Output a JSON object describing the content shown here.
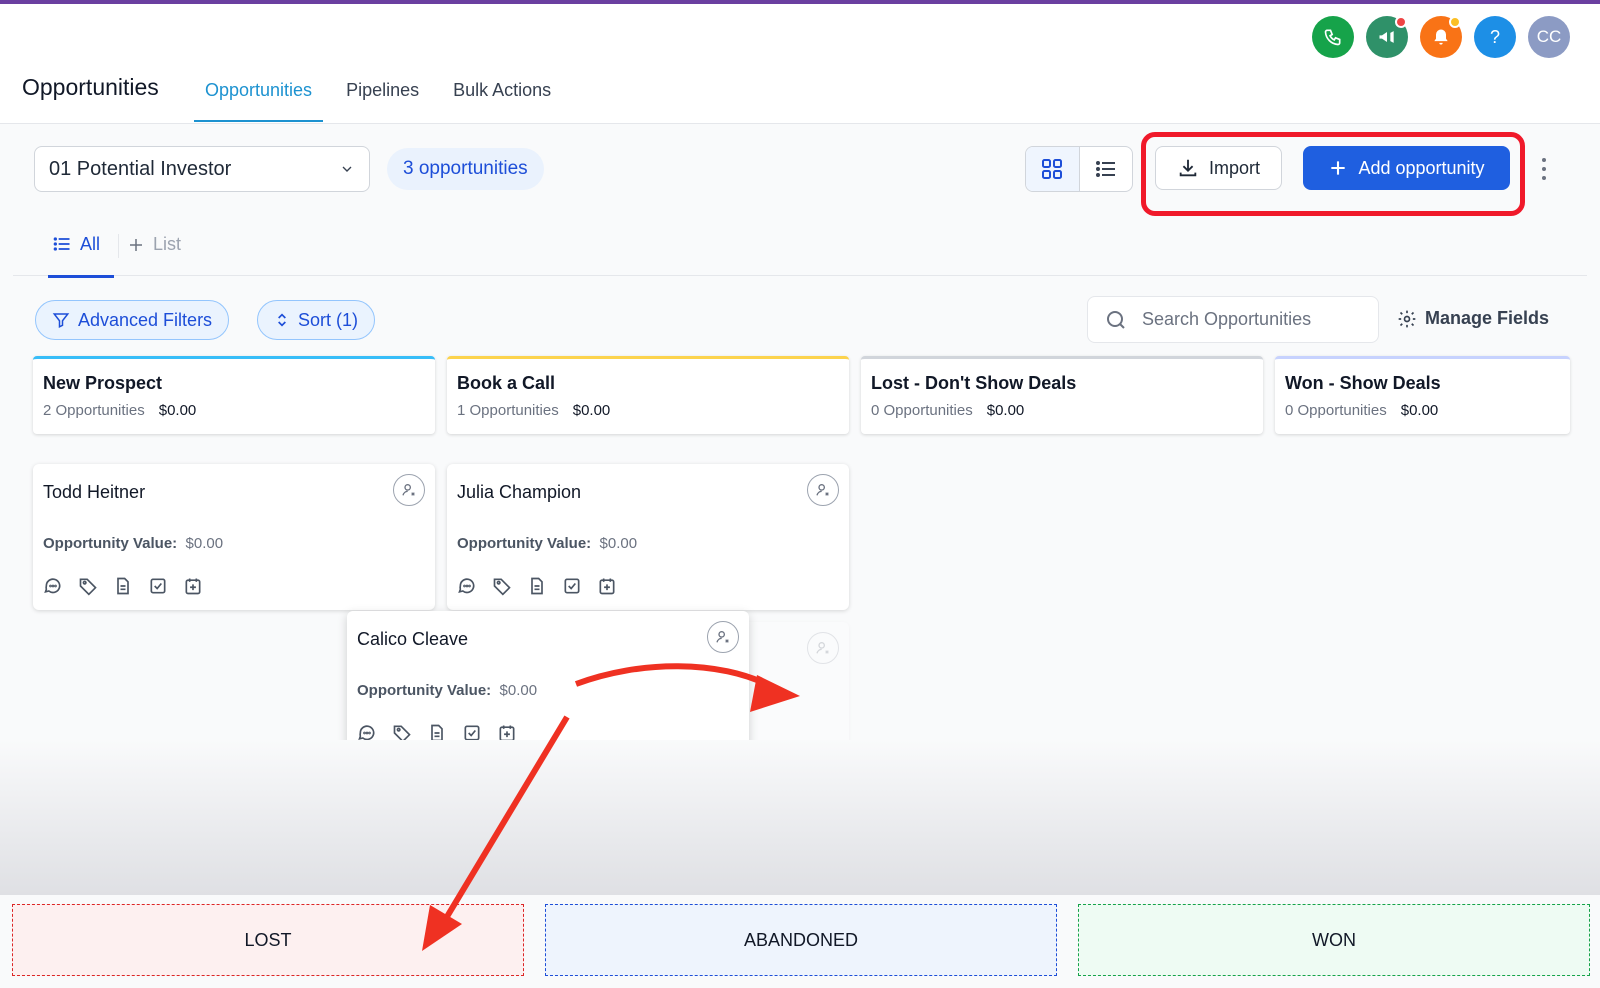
{
  "header": {
    "page_title": "Opportunities",
    "tabs": [
      {
        "label": "Opportunities",
        "active": true
      },
      {
        "label": "Pipelines"
      },
      {
        "label": "Bulk Actions"
      }
    ],
    "icons": [
      {
        "name": "phone-icon",
        "color": "#16a34a"
      },
      {
        "name": "megaphone-icon",
        "color": "#2f9169"
      },
      {
        "name": "bell-icon",
        "color": "#f97316"
      },
      {
        "name": "help-icon",
        "color": "#1d8fe6"
      }
    ],
    "avatar_initials": "CC"
  },
  "toolbar": {
    "pipeline": "01 Potential Investor",
    "count": "3 opportunities",
    "import_label": "Import",
    "add_label": "Add opportunity"
  },
  "list_tabs": {
    "all_label": "All",
    "list_label": "List"
  },
  "filters": {
    "advanced_label": "Advanced Filters",
    "sort_label": "Sort (1)",
    "search_placeholder": "Search Opportunities",
    "manage_fields_label": "Manage Fields"
  },
  "columns": [
    {
      "title": "New Prospect",
      "count": "2 Opportunities",
      "value": "$0.00",
      "accent": "#38bdf8"
    },
    {
      "title": "Book a Call",
      "count": "1 Opportunities",
      "value": "$0.00",
      "accent": "#fcd34d"
    },
    {
      "title": "Lost - Don't Show Deals",
      "count": "0 Opportunities",
      "value": "$0.00",
      "accent": "#d1d5db"
    },
    {
      "title": "Won - Show Deals",
      "count": "0 Opportunities",
      "value": "$0.00",
      "accent": "#c7d2fe"
    }
  ],
  "cards": [
    {
      "name": "Todd Heitner",
      "value_label": "Opportunity Value:",
      "value": "$0.00"
    },
    {
      "name": "Julia Champion",
      "value_label": "Opportunity Value:",
      "value": "$0.00"
    },
    {
      "name": "Calico Cleave",
      "value_label": "Opportunity Value:",
      "value": "$0.00"
    }
  ],
  "drop_zones": [
    {
      "label": "LOST",
      "bg": "#fdf0f0",
      "border": "#dc2626"
    },
    {
      "label": "ABANDONED",
      "bg": "#eef4fd",
      "border": "#1d4ed8"
    },
    {
      "label": "WON",
      "bg": "#eefbf3",
      "border": "#16a34a"
    }
  ]
}
